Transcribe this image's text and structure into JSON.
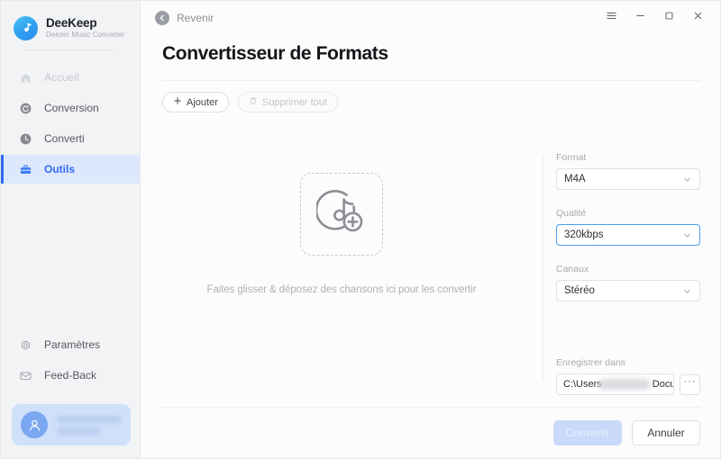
{
  "brand": {
    "name": "DeeKeep",
    "subtitle": "Deezer Music Converter",
    "logo_icon": "deezer-note-logo",
    "accent_color": "#2f8ef0"
  },
  "sidebar": {
    "items": [
      {
        "label": "Accueil",
        "icon": "home-icon",
        "state": "dimmed"
      },
      {
        "label": "Conversion",
        "icon": "refresh-icon",
        "state": "normal"
      },
      {
        "label": "Converti",
        "icon": "clock-icon",
        "state": "normal"
      },
      {
        "label": "Outils",
        "icon": "briefcase-icon",
        "state": "active"
      }
    ],
    "bottom_items": [
      {
        "label": "Paramètres",
        "icon": "gear-icon"
      },
      {
        "label": "Feed-Back",
        "icon": "envelope-icon"
      }
    ],
    "user": {
      "avatar_icon": "user-icon",
      "name": "",
      "plan": ""
    },
    "active_color": "#2f6bf0",
    "active_bg": "#dee8fd"
  },
  "titlebar": {
    "back_label": "Revenir",
    "back_icon": "arrow-left-circle-icon",
    "window_buttons": [
      {
        "name": "menu-button",
        "icon": "hamburger-icon"
      },
      {
        "name": "minimize-button",
        "icon": "minimize-icon"
      },
      {
        "name": "maximize-button",
        "icon": "maximize-icon"
      },
      {
        "name": "close-button",
        "icon": "close-icon"
      }
    ]
  },
  "page": {
    "title": "Convertisseur de Formats"
  },
  "toolbar": {
    "add_label": "Ajouter",
    "add_icon": "plus-icon",
    "delete_all_label": "Supprimer tout",
    "delete_all_icon": "trash-icon",
    "delete_all_disabled": true
  },
  "dropzone": {
    "icon": "add-music-note-icon",
    "hint": "Faites glisser & déposez des chansons ici pour les convertir"
  },
  "settings": {
    "format": {
      "label": "Format",
      "value": "M4A",
      "chevron_icon": "chevron-down-icon",
      "focused": false
    },
    "quality": {
      "label": "Qualité",
      "value": "320kbps",
      "chevron_icon": "chevron-down-icon",
      "focused": true,
      "focus_color": "#4c9ef0"
    },
    "channels": {
      "label": "Canaux",
      "value": "Stéréo",
      "chevron_icon": "chevron-down-icon",
      "focused": false
    },
    "save_to": {
      "label": "Enregistrer dans",
      "value_prefix": "C:\\Users",
      "value_suffix": "Documen",
      "browse_label": "···",
      "browse_icon": "ellipsis-icon"
    }
  },
  "footer": {
    "convert_label": "Convertir",
    "convert_disabled": true,
    "cancel_label": "Annuler"
  }
}
